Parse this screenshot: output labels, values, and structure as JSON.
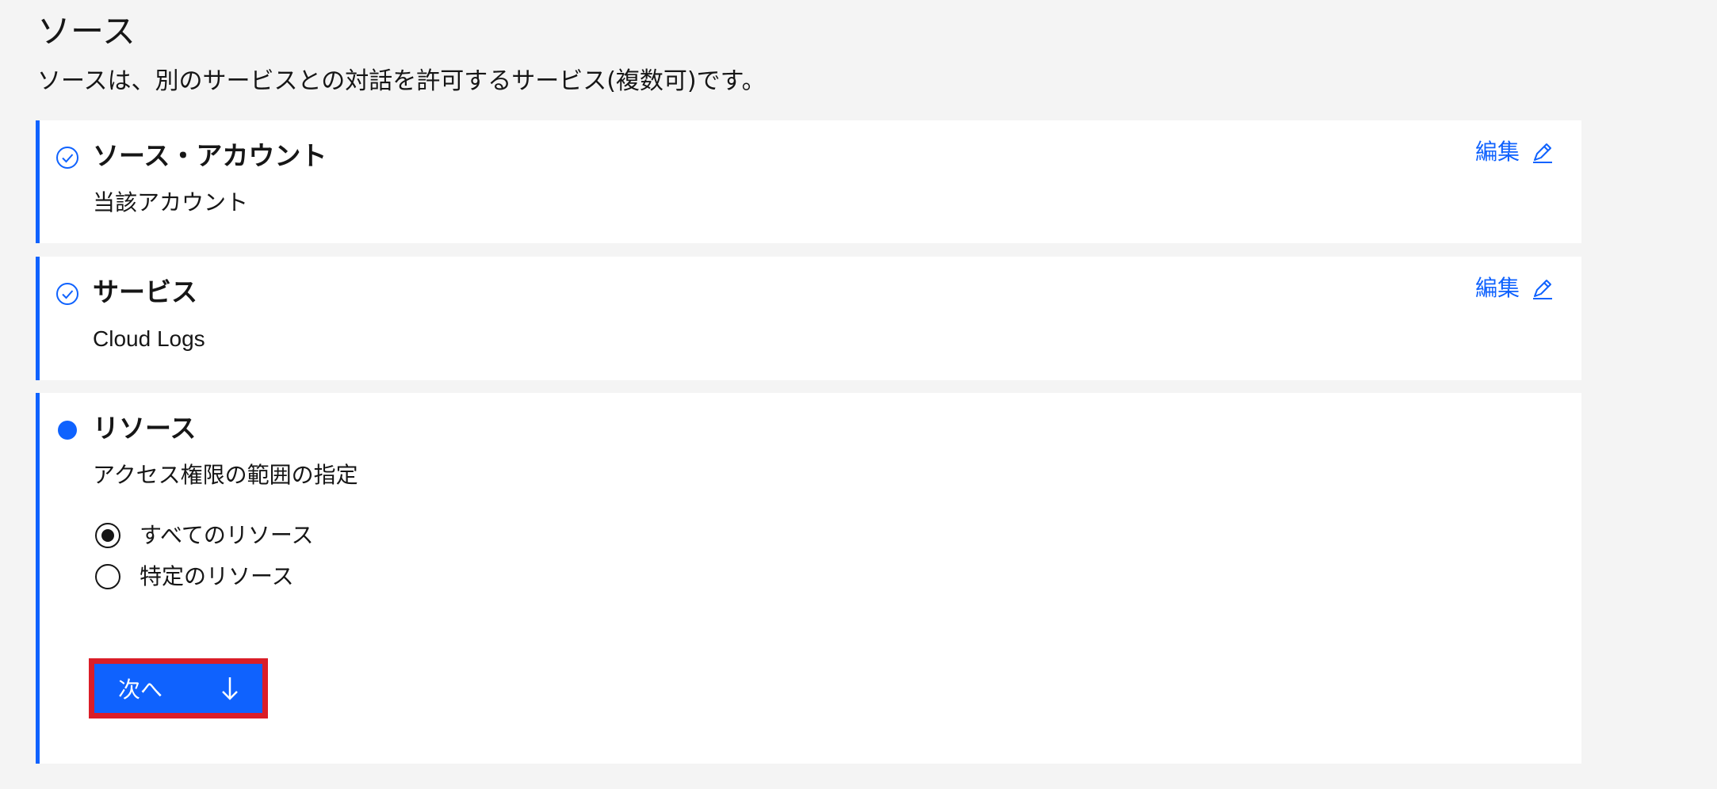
{
  "page": {
    "heading": "ソース",
    "description": "ソースは、別のサービスとの対話を許可するサービス(複数可)です。"
  },
  "steps": [
    {
      "title": "ソース・アカウント",
      "value": "当該アカウント",
      "status": "complete",
      "edit_label": "編集",
      "icon": "checkmark-outline-icon"
    },
    {
      "title": "サービス",
      "value": "Cloud Logs",
      "status": "complete",
      "edit_label": "編集",
      "icon": "checkmark-outline-icon"
    },
    {
      "title": "リソース",
      "value": "アクセス権限の範囲の指定",
      "status": "current",
      "icon": "current-step-dot-icon",
      "options": [
        {
          "label": "すべてのリソース",
          "selected": true
        },
        {
          "label": "特定のリソース",
          "selected": false
        }
      ],
      "next_label": "次へ",
      "next_icon": "arrow-down-icon"
    }
  ],
  "colors": {
    "accent": "#0f62fe",
    "highlight": "#da1e28",
    "background": "#f4f4f4",
    "card": "#ffffff",
    "text": "#161616"
  }
}
